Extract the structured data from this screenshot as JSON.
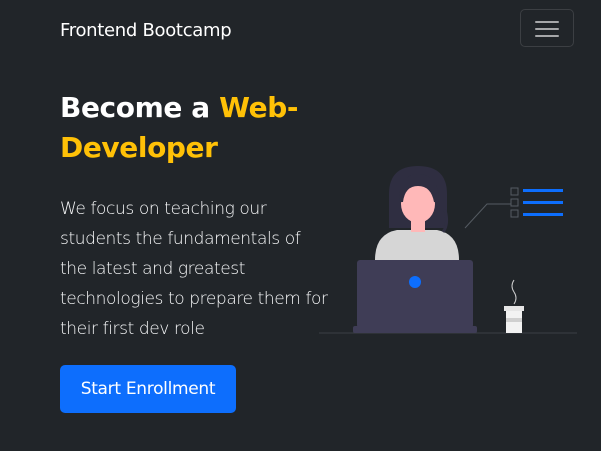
{
  "navbar": {
    "brand": "Frontend Bootcamp",
    "toggler_icon": "hamburger-menu-icon"
  },
  "hero": {
    "title_part1": "Become a ",
    "title_accent": "Web-Developer",
    "description": "We focus on teaching our students the fundamentals of the latest and greatest technologies to prepare them for their first dev role",
    "cta_label": "Start Enrollment"
  },
  "illustration": {
    "icon": "developer-at-laptop-illustration"
  },
  "colors": {
    "background": "#212529",
    "accent": "#ffc107",
    "primary": "#0d6efd",
    "laptop": "#3f3d56"
  }
}
